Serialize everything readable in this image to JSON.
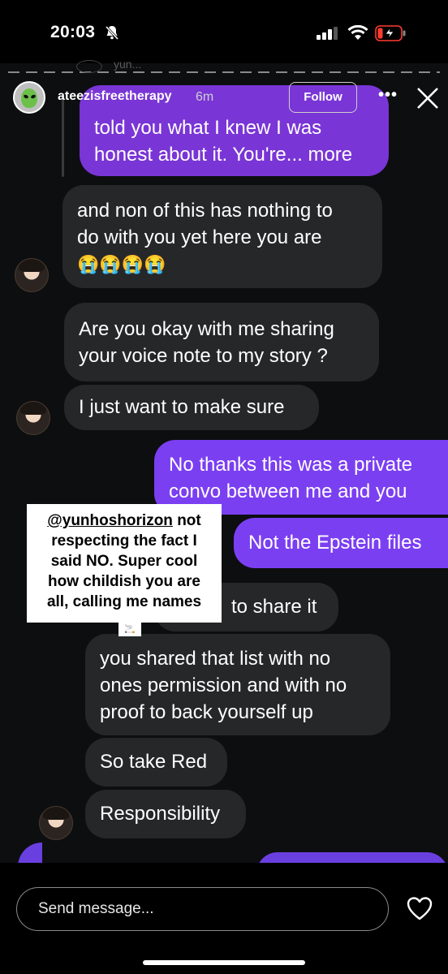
{
  "status_bar": {
    "time": "20:03"
  },
  "story_header": {
    "username": "ateezisfreetherapy",
    "time_ago": "6m",
    "follow_label": "Follow",
    "more_label": "•••",
    "reply_user": "yun..."
  },
  "messages": [
    {
      "side": "right",
      "color": "purple",
      "text_lines": [
        "told you what I knew I was",
        "honest about it. You're... more"
      ]
    },
    {
      "side": "left",
      "text_lines": [
        "and non of this has nothing to",
        "do with you yet here you are",
        "😭😭😭😭"
      ]
    },
    {
      "side": "left",
      "text_lines": [
        "Are you okay with me sharing",
        "your voice note to my story ?"
      ]
    },
    {
      "side": "left",
      "text_lines": [
        "I just want to make sure"
      ]
    },
    {
      "side": "right",
      "text_lines": [
        "No thanks this was a private",
        "convo between me and you"
      ]
    },
    {
      "side": "right",
      "text_lines": [
        "Not the Epstein files"
      ]
    },
    {
      "side": "left",
      "text_lines": [
        "to share it"
      ]
    },
    {
      "side": "left",
      "text_lines": [
        "you shared that list with no",
        "ones permission and with no",
        "proof to back yourself up"
      ]
    },
    {
      "side": "left",
      "text_lines": [
        "So take Red"
      ]
    },
    {
      "side": "left",
      "text_lines": [
        "Responsibility"
      ]
    }
  ],
  "sticker": {
    "mention": "@yunhoshorizon",
    "lines": [
      " not",
      "respecting the fact I",
      "said NO. Super cool",
      "how childish you are",
      "all, calling me names"
    ]
  },
  "bottom": {
    "message_placeholder": "Send message..."
  },
  "colors": {
    "purple_bubble": "#7b3ff2",
    "gray_bubble": "#262729",
    "background": "#0d0e10"
  }
}
